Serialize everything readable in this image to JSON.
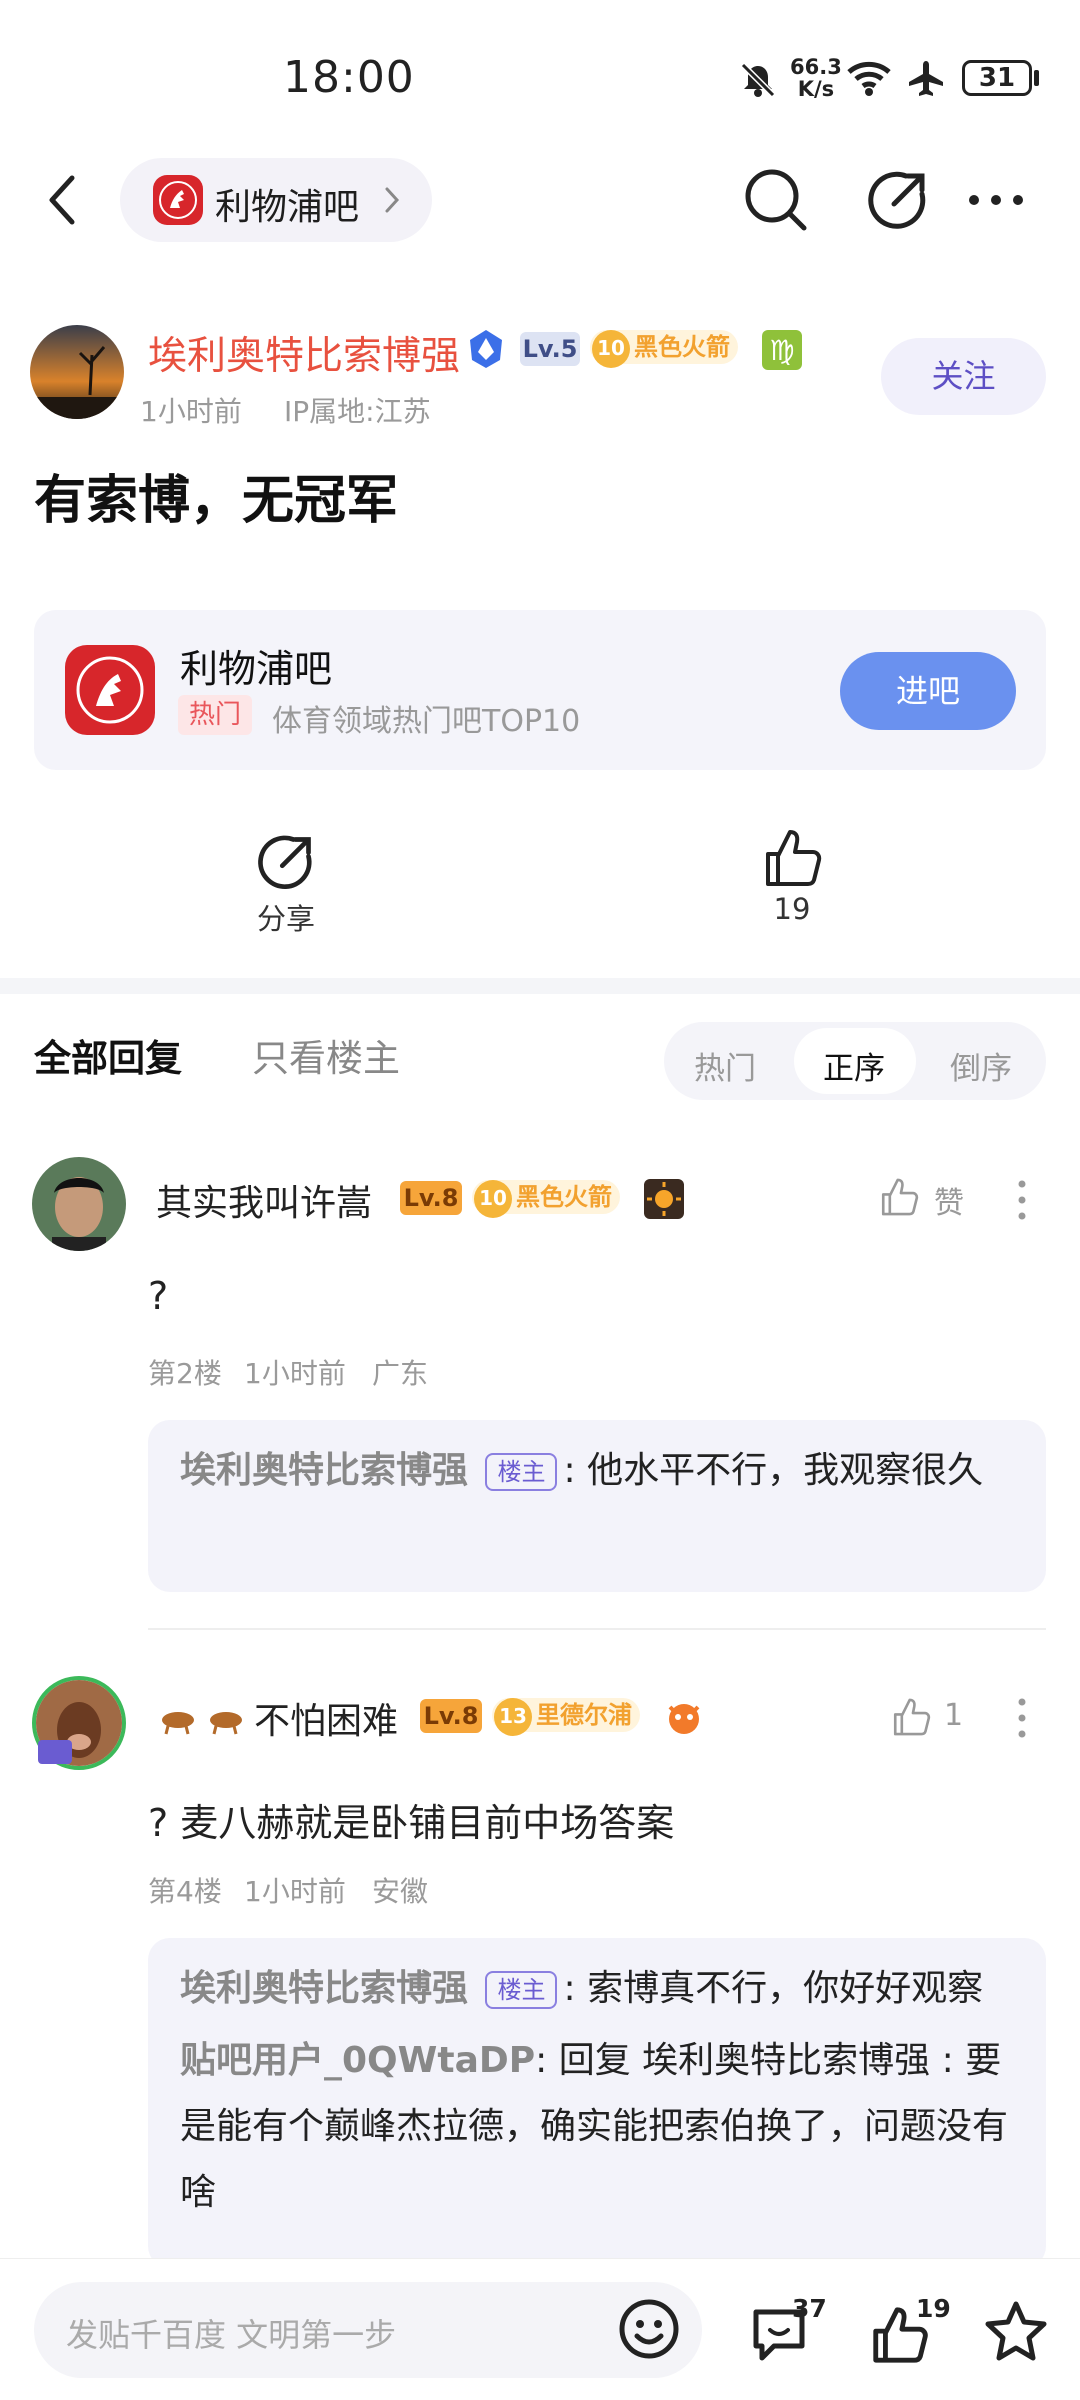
{
  "status_bar": {
    "time": "18:00",
    "speed_value": "66.3",
    "speed_unit": "K/s",
    "battery": "31"
  },
  "nav": {
    "forum_name": "利物浦吧"
  },
  "post": {
    "author": "埃利奥特比索博强",
    "level": "Lv.5",
    "badge_number": "10",
    "badge_title": "黑色火箭",
    "time": "1小时前",
    "ip": "IP属地:江苏",
    "follow_label": "关注",
    "title": "有索博，无冠军"
  },
  "forum_card": {
    "name": "利物浦吧",
    "tag": "热门",
    "desc": "体育领域热门吧TOP10",
    "enter_label": "进吧"
  },
  "actions": {
    "share_label": "分享",
    "like_count": "19"
  },
  "reply_tabs": {
    "all": "全部回复",
    "op_only": "只看楼主",
    "sort_hot": "热门",
    "sort_asc": "正序",
    "sort_desc": "倒序"
  },
  "replies": [
    {
      "user": "其实我叫许嵩",
      "level": "Lv.8",
      "badge_number": "10",
      "badge_title": "黑色火箭",
      "like_label": "赞",
      "body": "?",
      "meta_floor": "第2楼",
      "meta_time": "1小时前",
      "meta_loc": "广东",
      "quotes": [
        {
          "name": "埃利奥特比索博强",
          "tag": "楼主",
          "colon": ":",
          "text": "他水平不行，我观察很久"
        }
      ]
    },
    {
      "user": "不怕困难",
      "level": "Lv.8",
      "badge_number": "13",
      "badge_title": "里德尔浦",
      "like_label": "1",
      "body": "? 麦八赫就是卧铺目前中场答案",
      "meta_floor": "第4楼",
      "meta_time": "1小时前",
      "meta_loc": "安徽",
      "quotes": [
        {
          "name": "埃利奥特比索博强",
          "tag": "楼主",
          "colon": ":",
          "text": "索博真不行，你好好观察"
        },
        {
          "name": "贴吧用户_0QWtaDP",
          "colon": ":",
          "reply_prefix": "回复 埃利奥特比索博强 :",
          "text": "要是能有个巅峰杰拉德，确实能把索伯换了，问题没有啥"
        }
      ]
    }
  ],
  "bottom_bar": {
    "placeholder": "发贴千百度 文明第一步",
    "comment_count": "37",
    "like_count": "19"
  },
  "colors": {
    "author_red": "#e8513f",
    "accent_purple": "#5d4fc4",
    "enter_blue": "#6a91ef",
    "level_orange": "#f6a53a"
  }
}
